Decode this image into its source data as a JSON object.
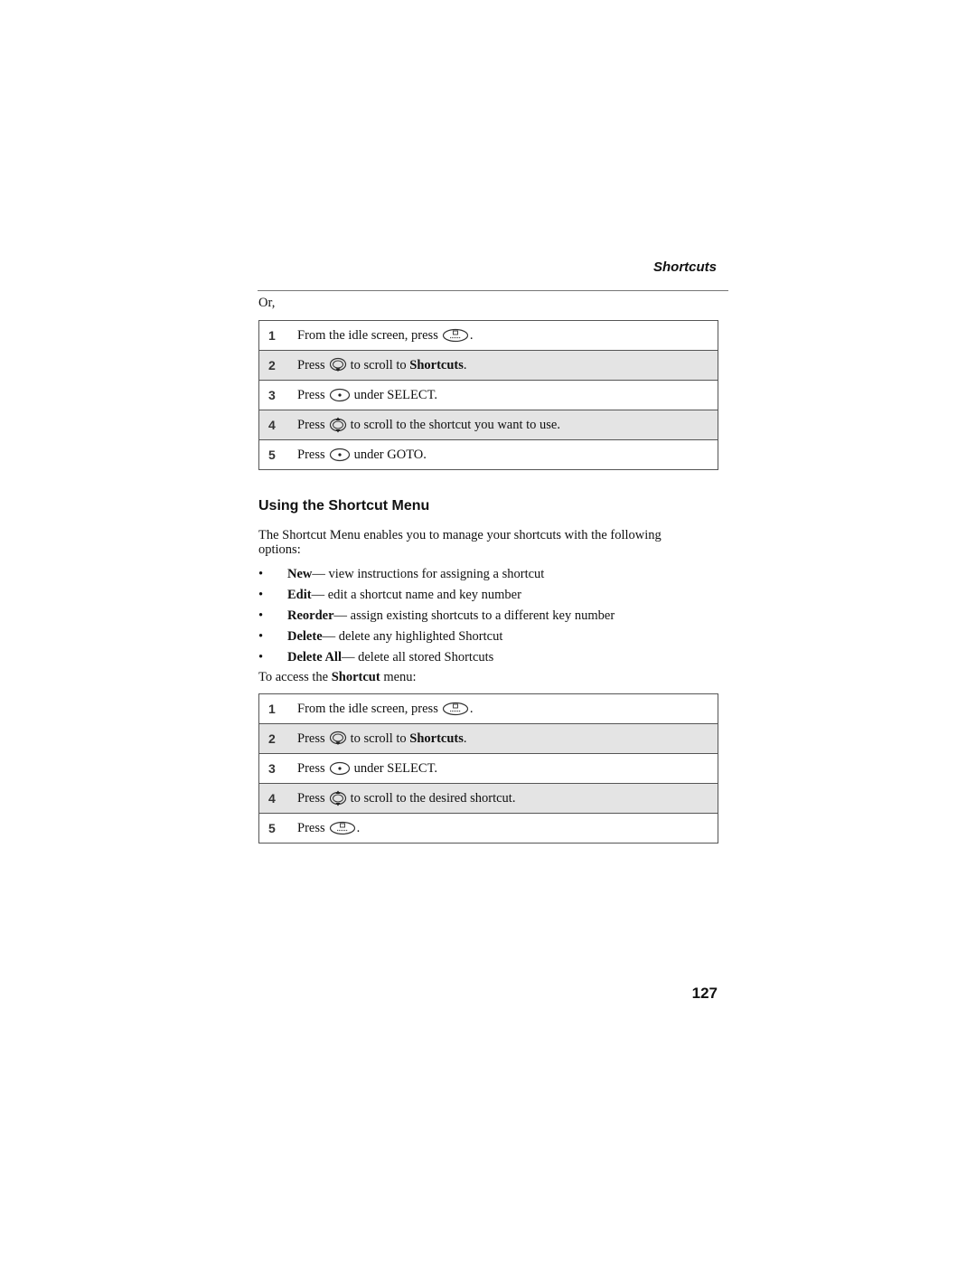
{
  "header": {
    "running_head": "Shortcuts"
  },
  "intro": {
    "or_text": "Or,"
  },
  "procedure_1": {
    "steps": [
      {
        "num": "1",
        "pre": "From the idle screen, press",
        "icon": "menu-key-icon",
        "bold": "",
        "post": "."
      },
      {
        "num": "2",
        "pre": "Press",
        "icon": "scroll-down-key-icon",
        "mid": "to scroll to",
        "bold": "Shortcuts",
        "post": "."
      },
      {
        "num": "3",
        "pre": "Press",
        "icon": "select-key-icon",
        "mid": "under SELECT.",
        "bold": "",
        "post": ""
      },
      {
        "num": "4",
        "pre": "Press",
        "icon": "scroll-updown-key-icon",
        "mid": "to scroll to the shortcut you want to use.",
        "bold": "",
        "post": ""
      },
      {
        "num": "5",
        "pre": "Press",
        "icon": "select-key-icon",
        "mid": "under GOTO.",
        "bold": "",
        "post": ""
      }
    ]
  },
  "section": {
    "title": "Using the Shortcut Menu",
    "intro_line1": "The Shortcut Menu enables you to manage your shortcuts with the following",
    "intro_line2": "options:",
    "options": [
      {
        "term": "New",
        "desc": " — view instructions for assigning a shortcut"
      },
      {
        "term": "Edit",
        "desc": " — edit a shortcut name and key number"
      },
      {
        "term": "Reorder",
        "desc": " — assign existing shortcuts to a different key number"
      },
      {
        "term": "Delete",
        "desc": " — delete any highlighted Shortcut"
      },
      {
        "term": "Delete All",
        "desc": " — delete all stored Shortcuts"
      }
    ],
    "access_pre": "To access the ",
    "access_bold": "Shortcut",
    "access_post": " menu:"
  },
  "procedure_2": {
    "steps": [
      {
        "num": "1",
        "pre": "From the idle screen, press",
        "post": "."
      },
      {
        "num": "2",
        "pre": "Press",
        "mid": "to scroll to",
        "bold": "Shortcuts",
        "post": "."
      },
      {
        "num": "3",
        "pre": "Press",
        "mid": "under SELECT."
      },
      {
        "num": "4",
        "pre": "Press",
        "mid": "to scroll to the desired shortcut."
      },
      {
        "num": "5",
        "pre": "Press",
        "post": "."
      }
    ]
  },
  "footer": {
    "page_number": "127"
  }
}
